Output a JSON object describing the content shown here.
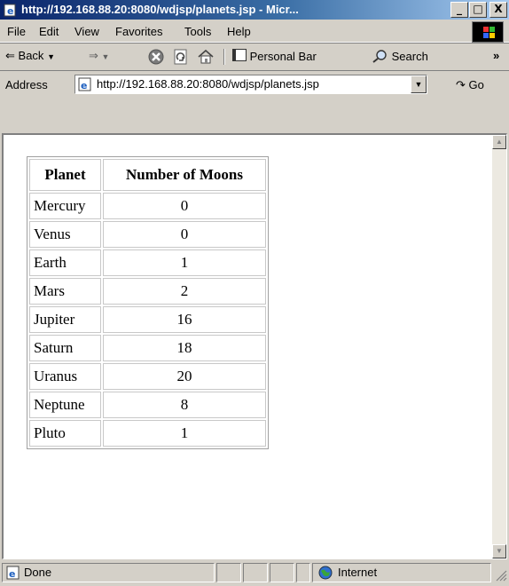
{
  "window": {
    "title": "http://192.168.88.20:8080/wdjsp/planets.jsp - Micr...",
    "minimize": "_",
    "maximize": "□",
    "close": "X"
  },
  "menu": [
    "File",
    "Edit",
    "View",
    "Favorites",
    "Tools",
    "Help"
  ],
  "toolbar": {
    "back": "Back",
    "forward_arrow": "⇒",
    "personal_bar": "Personal Bar",
    "search": "Search",
    "more": "»"
  },
  "address": {
    "label": "Address",
    "url": "http://192.168.88.20:8080/wdjsp/planets.jsp",
    "go": "Go"
  },
  "table": {
    "headers": [
      "Planet",
      "Number of Moons"
    ],
    "rows": [
      [
        "Mercury",
        "0"
      ],
      [
        "Venus",
        "0"
      ],
      [
        "Earth",
        "1"
      ],
      [
        "Mars",
        "2"
      ],
      [
        "Jupiter",
        "16"
      ],
      [
        "Saturn",
        "18"
      ],
      [
        "Uranus",
        "20"
      ],
      [
        "Neptune",
        "8"
      ],
      [
        "Pluto",
        "1"
      ]
    ]
  },
  "status": {
    "left": "Done",
    "zone": "Internet"
  },
  "icons": {
    "title": "ie-page-icon",
    "back": "back-arrow-icon",
    "forward": "forward-arrow-icon",
    "stop": "stop-icon",
    "refresh": "refresh-icon",
    "home": "home-icon",
    "search": "search-icon"
  }
}
